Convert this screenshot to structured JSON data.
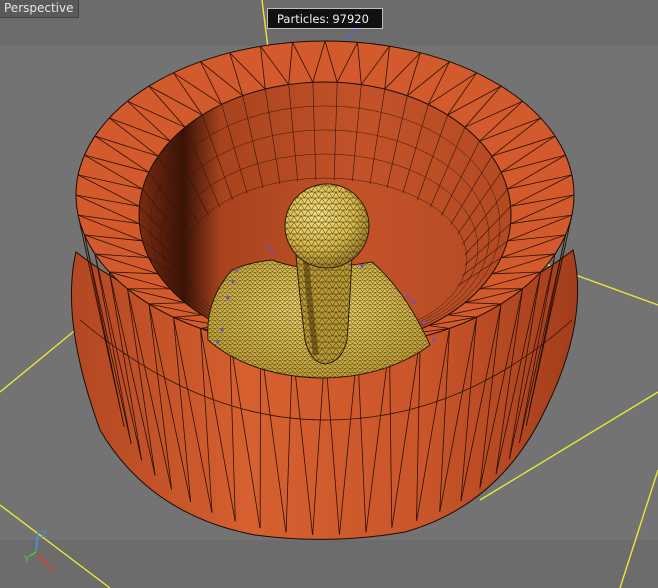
{
  "viewport": {
    "label": "Perspective",
    "particles_label": "Particles:",
    "particles_count": "97920"
  },
  "axis_gizmo": {
    "x": "X",
    "y": "Y",
    "z": "Z"
  },
  "colors": {
    "background": "#727272",
    "grid_line": "#e8e836",
    "mortar": "#c9542c",
    "mortar_dark": "#8a3416",
    "fluid": "#d9bf52",
    "wire": "#1c1208"
  }
}
